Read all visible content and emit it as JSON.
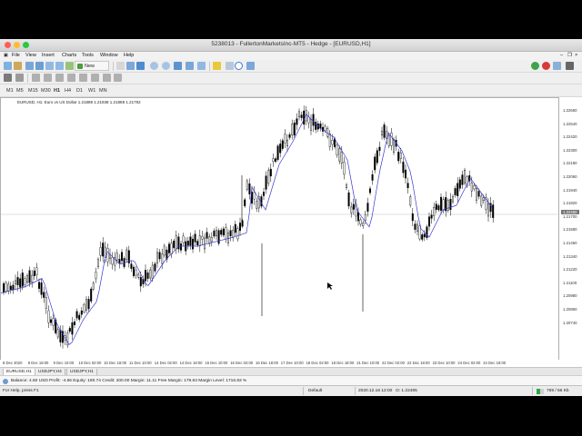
{
  "window": {
    "title": "5238013 - FullertonMarketsInc-MT5 - Hedge - [EURUSD,H1]"
  },
  "menu": [
    "File",
    "View",
    "Insert",
    "Charts",
    "Tools",
    "Window",
    "Help"
  ],
  "toolbar": {
    "new_order": "New Order"
  },
  "timeframes": [
    "M1",
    "M5",
    "M15",
    "M30",
    "H1",
    "H4",
    "D1",
    "W1",
    "MN"
  ],
  "chart": {
    "header": "EURUSD, H1:  Euro vs US Dollar  1.21889  1.21938  1.21888  1.21792",
    "bid_label": "1.22450",
    "price_ticks": [
      "1.22660",
      "1.22540",
      "1.22420",
      "1.22300",
      "1.22180",
      "1.22060",
      "1.21940",
      "1.21820",
      "1.21700",
      "1.21580",
      "1.21460",
      "1.21340",
      "1.21220",
      "1.21100",
      "1.20980",
      "1.20860",
      "1.20740"
    ],
    "time_ticks": [
      "8 Dec 2020",
      "9 Dec 18:00",
      "9 Dec 10:00",
      "10 Dec 02:00",
      "10 Dec 18:00",
      "11 Dec 10:00",
      "14 Dec 02:00",
      "14 Dec 18:00",
      "15 Dec 10:00",
      "16 Dec 02:00",
      "16 Dec 18:00",
      "17 Dec 10:00",
      "18 Dec 02:00",
      "18 Dec 18:00",
      "21 Dec 10:00",
      "22 Dec 02:00",
      "22 Dec 18:00",
      "23 Dec 10:00",
      "24 Dec 02:00",
      "24 Dec 18:00"
    ]
  },
  "tabs": [
    "EURUSD,H1",
    "USDJPY,H4",
    "USDJPY,H1"
  ],
  "terminal": {
    "text": "Balance: 4.60 USD  Profit: -4.66  Equity: 190.74  Credit: 200.00  Margin: 11.11  Free Margin: 179.63  Margin Level: 1716.83 %"
  },
  "status": {
    "help": "For Help, press F1",
    "profile": "Default",
    "datetime": "2020.12.16 12:00",
    "open": "O: 1.22495",
    "traffic": "769 / 56 Kb"
  },
  "colors": {
    "up": "#1e8a2a",
    "down": "#e0242c",
    "candle": "#000000",
    "ma": "#3a3ad0"
  }
}
